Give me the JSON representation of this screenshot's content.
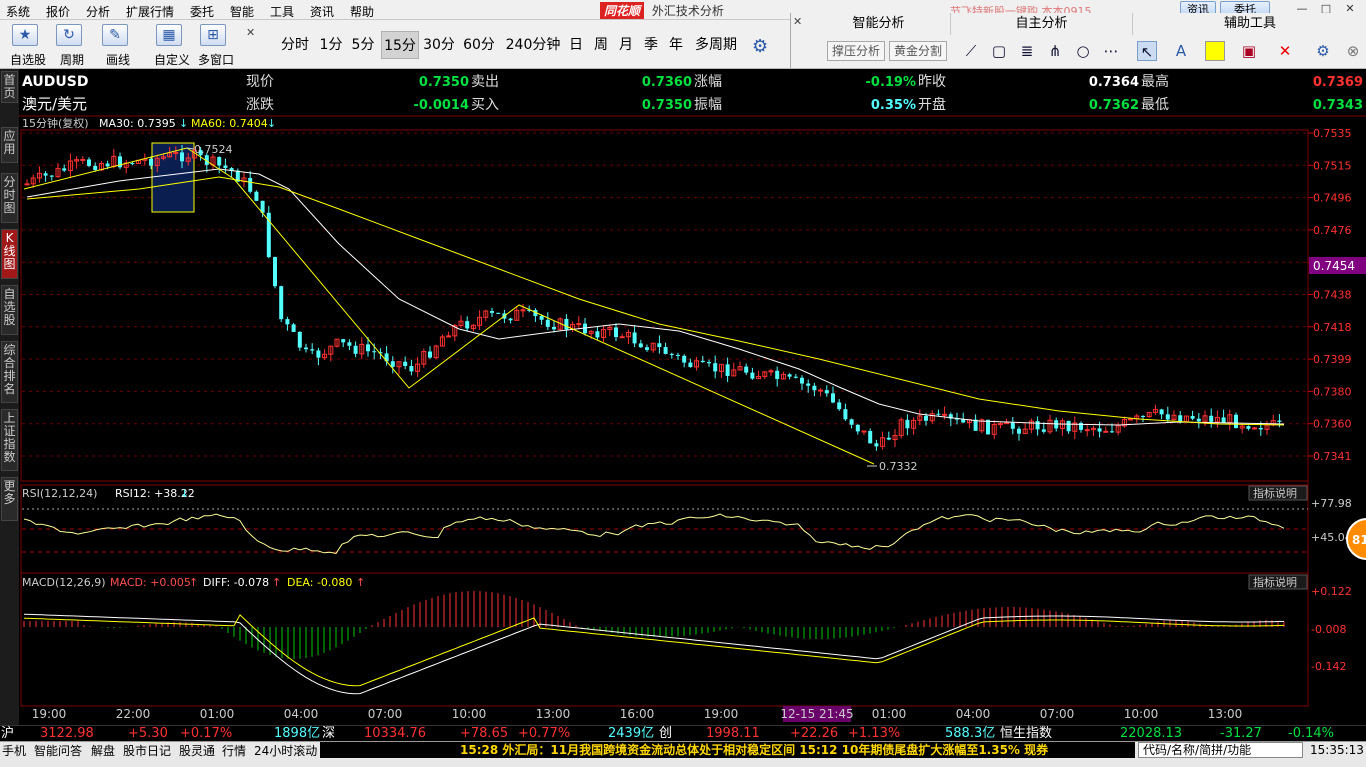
{
  "menubar": {
    "items": [
      "系统",
      "报价",
      "分析",
      "扩展行情",
      "委托",
      "智能",
      "工具",
      "资讯",
      "帮助"
    ],
    "logo": "同花顺",
    "window_title": "外汇技术分析",
    "promo": "节飞特新股一键购   本本0915",
    "btn_info": "资讯",
    "btn_trade": "委托"
  },
  "toolbar": {
    "buttons": [
      {
        "label": "自选股",
        "icon": "star-icon"
      },
      {
        "label": "周期",
        "icon": "cycle-icon"
      },
      {
        "label": "画线",
        "icon": "pencil-icon"
      },
      {
        "label": "自定义",
        "icon": "custom-icon"
      },
      {
        "label": "多窗口",
        "icon": "grid-icon"
      }
    ],
    "periods": [
      "分时",
      "1分",
      "5分",
      "15分",
      "30分",
      "60分",
      "240分钟",
      "日",
      "周",
      "月",
      "季",
      "年",
      "多周期"
    ],
    "active_period": "15分"
  },
  "rpanel": {
    "tabs": [
      "智能分析",
      "自主分析",
      "辅助工具"
    ],
    "smart_buttons": [
      "撑压分析",
      "黄金分割"
    ]
  },
  "nav": {
    "tabs": [
      "首页",
      "应用",
      "分时图",
      "K线图",
      "自选股",
      "综合排名",
      "上证指数",
      "更多"
    ],
    "active": "K线图"
  },
  "quote": {
    "symbol": "AUDUSD",
    "name": "澳元/美元",
    "labels": {
      "price": "现价",
      "bid": "卖出",
      "change_pct": "涨幅",
      "prev_close": "昨收",
      "high": "最高",
      "change": "涨跌",
      "ask": "买入",
      "amplitude": "振幅",
      "open": "开盘",
      "low": "最低"
    },
    "values": {
      "price": "0.7350",
      "bid": "0.7360",
      "change_pct": "-0.19%",
      "prev_close": "0.7364",
      "high": "0.7369",
      "change": "-0.0014",
      "ask": "0.7350",
      "amplitude": "0.35%",
      "open": "0.7362",
      "low": "0.7343"
    }
  },
  "chart_header": {
    "period": "15分钟(复权)",
    "ma30": "MA30: 0.7395",
    "ma60": "MA60: 0.7404"
  },
  "indicator_help": "指标说明",
  "rsi": {
    "label": "RSI(12,12,24)",
    "value": "RSI12: +38.22"
  },
  "macd": {
    "label": "MACD(12,26,9)",
    "macd": "MACD: +0.005",
    "diff": "DIFF: -0.078",
    "dea": "DEA: -0.080"
  },
  "badge": "81",
  "colors": {
    "up": "#ff3232",
    "down": "#54ffff",
    "ma30": "#ffffff",
    "ma60": "#ffff00",
    "price_tag": "#800080"
  },
  "chart_data": [
    {
      "type": "candlestick",
      "title": "AUDUSD 15分钟",
      "ylim": [
        0.7332,
        0.7535
      ],
      "y_ticks": [
        "0.7535",
        "0.7515",
        "0.7496",
        "0.7476",
        "0.7456",
        "0.7438",
        "0.7418",
        "0.7399",
        "0.7380",
        "0.7360",
        "0.7341"
      ],
      "x_ticks": [
        "19:00",
        "22:00",
        "01:00",
        "04:00",
        "07:00",
        "10:00",
        "13:00",
        "16:00",
        "19:00",
        "12-15 21:45",
        "01:00",
        "04:00",
        "07:00",
        "10:00",
        "13:00"
      ],
      "current_price": "0.7454",
      "annotations": [
        {
          "text": "0.7524",
          "value": 0.7524
        },
        {
          "text": "0.7332",
          "value": 0.7332
        }
      ],
      "series": [
        {
          "name": "MA30"
        },
        {
          "name": "MA60"
        }
      ]
    },
    {
      "type": "line",
      "title": "RSI",
      "y_ticks": [
        "+77.98",
        "+45.04"
      ]
    },
    {
      "type": "bar",
      "title": "MACD",
      "y_ticks": [
        "+0.122",
        "-0.008",
        "-0.142"
      ]
    }
  ],
  "indices": [
    {
      "name": "沪",
      "value": "3122.98",
      "change": "+5.30",
      "pct": "+0.17%",
      "vol": "1898亿"
    },
    {
      "name": "深",
      "value": "10334.76",
      "change": "+78.65",
      "pct": "+0.77%",
      "vol": "2439亿"
    },
    {
      "name": "创",
      "value": "1998.11",
      "change": "+22.26",
      "pct": "+1.13%",
      "vol": "588.3亿"
    },
    {
      "name": "恒生指数",
      "value": "22028.13",
      "change": "-31.27",
      "pct": "-0.14%"
    }
  ],
  "status": {
    "items": [
      "手机",
      "智能问答",
      "解盘",
      "股市日记",
      "股灵通",
      "行情",
      "24小时滚动"
    ],
    "news": "15:28 外汇局：11月我国跨境资金流动总体处于相对稳定区间          15:12 10年期债尾盘扩大涨幅至1.35% 现券",
    "search": "代码/名称/简拼/功能",
    "clock": "15:35:13"
  }
}
